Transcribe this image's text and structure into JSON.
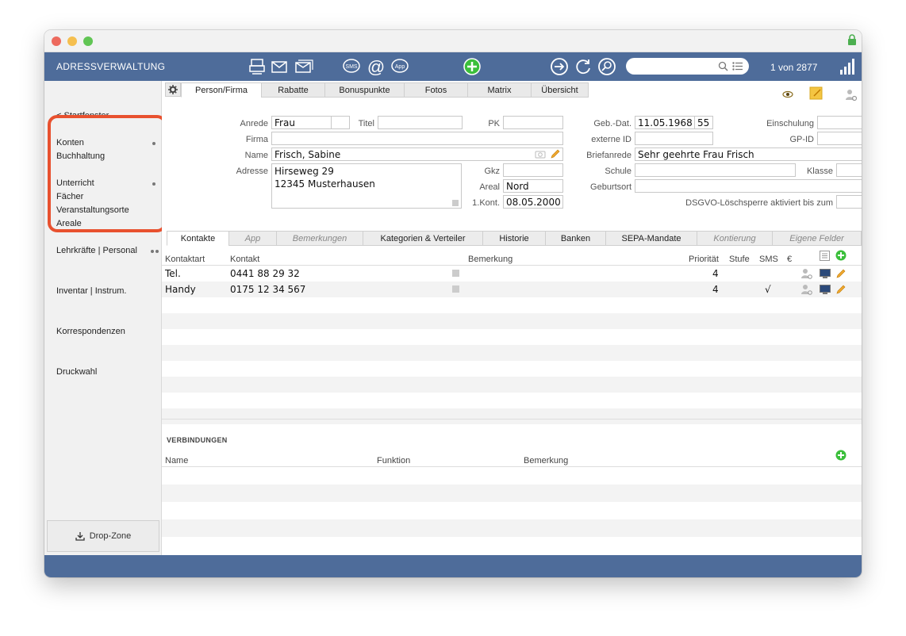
{
  "app": {
    "title": "ADRESSVERWALTUNG",
    "record_counter": "1 von 2877",
    "search_placeholder": ""
  },
  "colors": {
    "toolbar": "#4e6c9a",
    "highlight": "#e8512f",
    "add_green": "#3bbf3b"
  },
  "sidebar": {
    "start": "< Startfenster",
    "items": [
      "Konten",
      "Buchhaltung",
      "Unterricht",
      "Fächer",
      "Veranstaltungsorte",
      "Areale",
      "Lehrkräfte | Personal",
      "Inventar | Instrum.",
      "Korrespondenzen",
      "Druckwahl"
    ],
    "dropzone": "Drop-Zone"
  },
  "tabs": [
    "Person/Firma",
    "Rabatte",
    "Bonuspunkte",
    "Fotos",
    "Matrix",
    "Übersicht"
  ],
  "form": {
    "anrede_label": "Anrede",
    "anrede": "Frau",
    "titel_label": "Titel",
    "titel": "",
    "pk_label": "PK",
    "pk": "",
    "firma_label": "Firma",
    "firma": "",
    "name_label": "Name",
    "name": "Frisch, Sabine",
    "adresse_label": "Adresse",
    "adresse": "Hirseweg 29\n12345 Musterhausen",
    "gkz_label": "Gkz",
    "gkz": "",
    "areal_label": "Areal",
    "areal": "Nord",
    "kont_label": "1.Kont.",
    "kont": "08.05.2000",
    "gebdat_label": "Geb.-Dat.",
    "gebdat": "11.05.1968",
    "alter": "55",
    "extid_label": "externe ID",
    "extid": "",
    "briefanrede_label": "Briefanrede",
    "briefanrede": "Sehr geehrte Frau Frisch",
    "schule_label": "Schule",
    "schule": "",
    "geburtsort_label": "Geburtsort",
    "geburtsort": "",
    "einschulung_label": "Einschulung",
    "einschulung": "",
    "gpid_label": "GP-ID",
    "gpid": "",
    "klasse_label": "Klasse",
    "klasse": "",
    "dsgvo_label": "DSGVO-Löschsperre aktiviert bis zum",
    "dsgvo": ""
  },
  "subtabs": [
    "Kontakte",
    "App",
    "Bemerkungen",
    "Kategorien & Verteiler",
    "Historie",
    "Banken",
    "SEPA-Mandate",
    "Kontierung",
    "Eigene Felder"
  ],
  "contacts": {
    "headers": [
      "Kontaktart",
      "Kontakt",
      "Bemerkung",
      "Priorität",
      "Stufe",
      "SMS",
      "€"
    ],
    "rows": [
      {
        "art": "Tel.",
        "kontakt": "0441 88 29 32",
        "prio": "4",
        "sms": ""
      },
      {
        "art": "Handy",
        "kontakt": "0175 12 34 567",
        "prio": "4",
        "sms": "√"
      }
    ]
  },
  "connections": {
    "title": "VERBINDUNGEN",
    "headers": [
      "Name",
      "Funktion",
      "Bemerkung"
    ]
  }
}
